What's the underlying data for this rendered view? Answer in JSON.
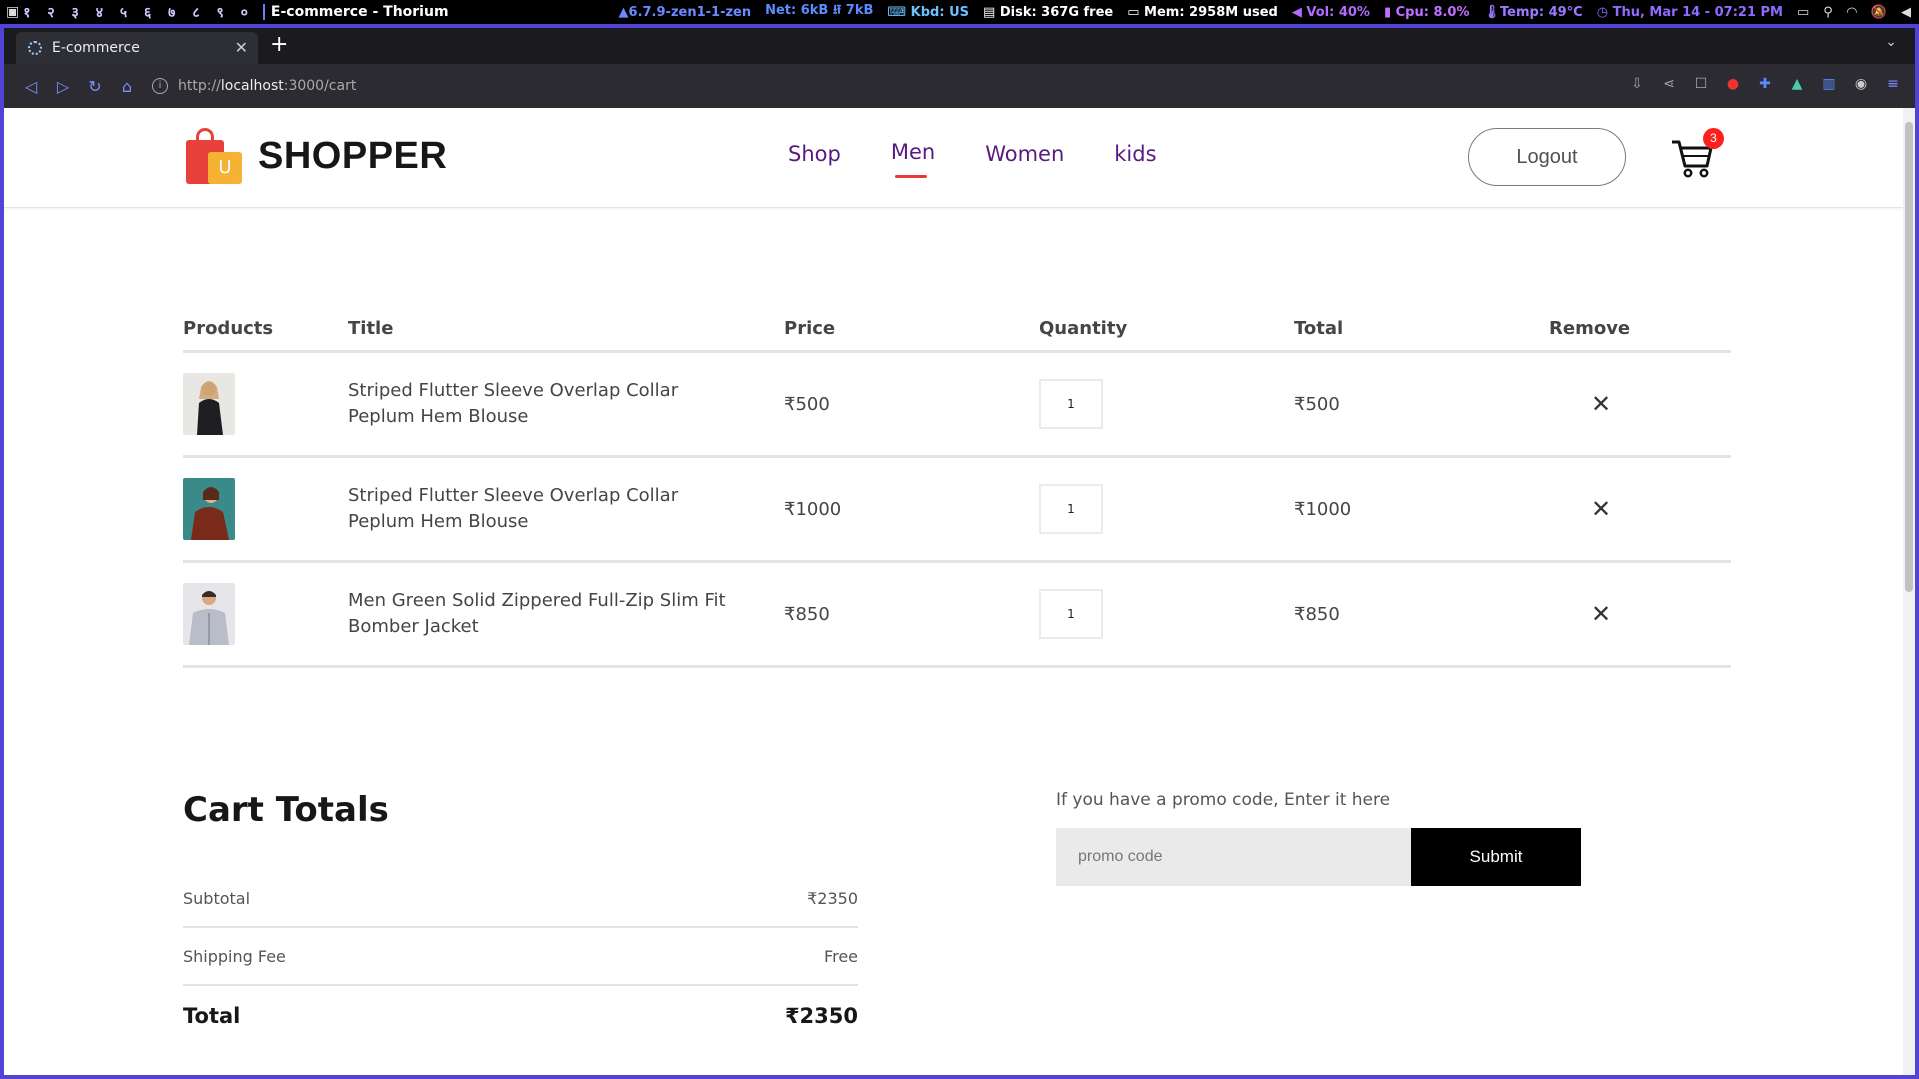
{
  "system_bar": {
    "workspaces": [
      "१",
      "२",
      "३",
      "४",
      "५",
      "६",
      "७",
      "८",
      "९",
      "०"
    ],
    "window_title": "E-commerce - Thorium",
    "kernel": "6.7.9-zen1-1-zen",
    "net": "Net: 6kB ⭿ 7kB",
    "kbd": "Kbd: US",
    "disk": "Disk: 367G free",
    "mem": "Mem: 2958M used",
    "vol": "Vol: 40%",
    "cpu": "Cpu: 8.0%",
    "temp": "Temp: 49°C",
    "datetime": "Thu, Mar 14 - 07:21 PM"
  },
  "browser": {
    "tab_title": "E-commerce",
    "url_prefix": "http://",
    "url_host": "localhost",
    "url_path": ":3000/cart"
  },
  "navbar": {
    "brand": "SHOPPER",
    "logo_letter": "U",
    "menu": [
      "Shop",
      "Men",
      "Women",
      "kids"
    ],
    "active_menu": "Men",
    "logout_label": "Logout",
    "cart_count": "3"
  },
  "cart": {
    "headers": [
      "Products",
      "Title",
      "Price",
      "Quantity",
      "Total",
      "Remove"
    ],
    "rows": [
      {
        "title": "Striped Flutter Sleeve Overlap Collar Peplum Hem Blouse",
        "price": "₹500",
        "quantity": "1",
        "total": "₹500"
      },
      {
        "title": "Striped Flutter Sleeve Overlap Collar Peplum Hem Blouse",
        "price": "₹1000",
        "quantity": "1",
        "total": "₹1000"
      },
      {
        "title": "Men Green Solid Zippered Full-Zip Slim Fit Bomber Jacket",
        "price": "₹850",
        "quantity": "1",
        "total": "₹850"
      }
    ],
    "remove_symbol": "✕"
  },
  "totals": {
    "heading": "Cart Totals",
    "subtotal_label": "Subtotal",
    "subtotal_value": "₹2350",
    "shipping_label": "Shipping Fee",
    "shipping_value": "Free",
    "total_label": "Total",
    "total_value": "₹2350"
  },
  "promo": {
    "hint": "If you have a promo code, Enter it here",
    "placeholder": "promo code",
    "submit_label": "Submit"
  },
  "colors": {
    "nav_text": "#571b80",
    "active_underline": "#e93a3a",
    "cart_badge": "#ff1f1f",
    "frame_border": "#5143d6"
  }
}
